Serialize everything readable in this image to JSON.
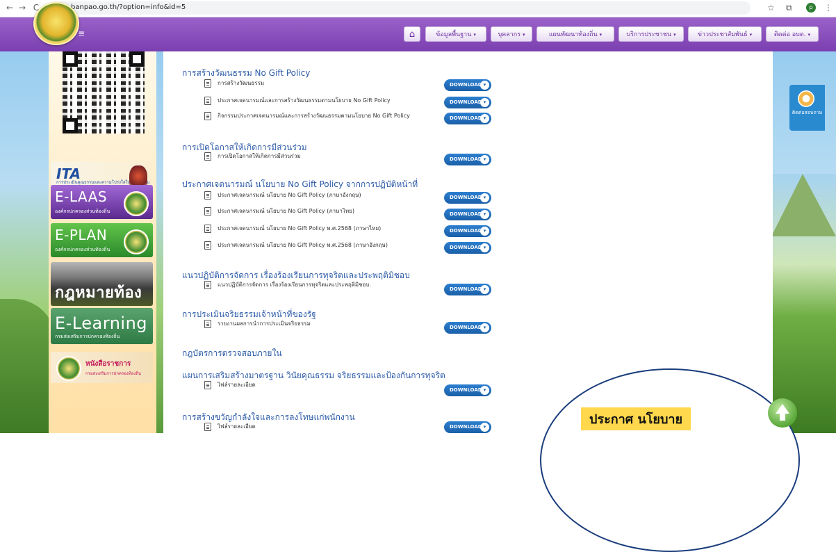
{
  "browser": {
    "url": "banpao.go.th/?option=info&id=5",
    "back_glyph": "←",
    "forward_glyph": "→",
    "reload_glyph": "C",
    "tune_glyph": "⇆",
    "star_glyph": "☆",
    "extensions_glyph": "⧉",
    "menu_glyph": "⋮",
    "profile_initial": "p"
  },
  "header": {
    "menu_glyph": "≡",
    "home_glyph": "⌂",
    "caret_glyph": "▾",
    "nav": [
      "ข้อมูลพื้นฐาน",
      "บุคลากร",
      "แผนพัฒนาท้องถิ่น",
      "บริการประชาชน",
      "ข่าวประชาสัมพันธ์",
      "ติดต่อ อบต."
    ]
  },
  "sidebar": {
    "ita_title": "ITA",
    "ita_sub": "การประเมินคุณธรรมและความโปร่งใสในการดำเนินงานของหน่วยงาน",
    "elaas_title": "E-LAAS",
    "elaas_sub": "องค์กรปกครองส่วนท้องถิ่น",
    "eplan_title": "E-PLAN",
    "eplan_sub": "องค์กรปกครองส่วนท้องถิ่น",
    "law_title": "กฎหมายท้องถิ่น",
    "elearning_title": "E-Learning",
    "elearning_sub": "กรมส่งเสริมการปกครองท้องถิ่น",
    "book_title": "หนังสือราชการ",
    "book_sub": "กรมส่งเสริมการปกครองท้องถิ่น"
  },
  "download_label": "DOWNLOAD",
  "download_glyph": "▾",
  "sections": [
    {
      "title": "การสร้างวัฒนธรรม No Gift Policy",
      "docs": [
        "การสร้างวัฒนธรรม",
        "ประกาศเจตนารมณ์และการสร้างวัฒนธรรมตามนโยบาย No Gift Policy",
        "กิจกรรมประกาศเจตนารมณ์และการสร้างวัฒนธรรมตามนโยบาย No Gift Policy"
      ]
    },
    {
      "title": "การเปิดโอกาสให้เกิดการมีส่วนร่วม",
      "docs": [
        "การเปิดโอกาสให้เกิดการมีส่วนร่วม"
      ]
    },
    {
      "title": "ประกาศเจตนารมณ์ นโยบาย No Gift Policy จากการปฏิบัติหน้าที่",
      "docs": [
        "ประกาศเจตนารมณ์ นโยบาย No Gift Policy (ภาษาอังกฤษ)",
        "ประกาศเจตนารมณ์ นโยบาย No Gift Policy (ภาษาไทย)",
        "ประกาศเจตนารมณ์ นโยบาย No Gift Policy พ.ศ.2568 (ภาษาไทย)",
        "ประกาศเจตนารมณ์ นโยบาย No Gift Policy พ.ศ.2568 (ภาษาอังกฤษ)"
      ]
    },
    {
      "title": "แนวปฏิบัติการจัดการ เรื่องร้องเรียนการทุจริตและประพฤติมิชอบ",
      "docs": [
        "แนวปฏิบัติการจัดการ เรื่องร้องเรียนการทุจริตและประพฤติมิชอบ."
      ]
    },
    {
      "title": "การประเมินจริยธรรมเจ้าหน้าที่ของรัฐ",
      "docs": [
        "รายงานผลการนำการประเมินจริยธรรม"
      ]
    },
    {
      "title": "กฎบัตรการตรวจสอบภายใน",
      "docs": []
    },
    {
      "title": "แผนการเสริมสร้างมาตรฐาน วินัยคุณธรรม จริยธรรมและป้องกันการทุจริต",
      "docs": [
        "ไฟล์รายละเอียด"
      ]
    },
    {
      "title": "การสร้างขวัญกำลังใจและการลงโทษแก่พนักงาน",
      "docs": [
        "ไฟล์รายละเอียด"
      ]
    }
  ],
  "contact_tab": {
    "label": "ติดต่อสอบถาม"
  },
  "popup": {
    "label": "ประกาศ นโยบาย"
  }
}
